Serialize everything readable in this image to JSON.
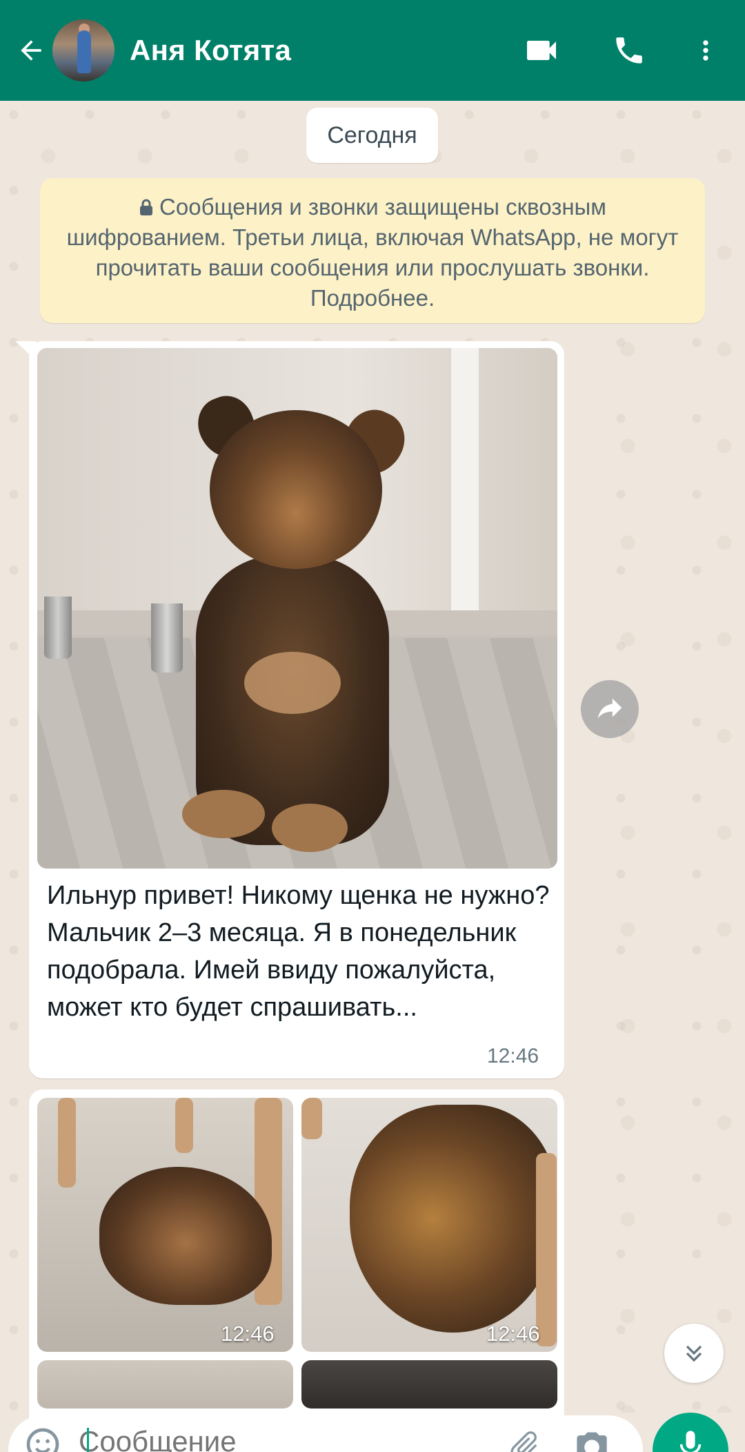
{
  "header": {
    "contact_name": "Аня Котята",
    "icons": {
      "back": "arrow-back-icon",
      "video": "video-call-icon",
      "voice": "phone-icon",
      "menu": "more-vert-icon"
    }
  },
  "date_chip": "Сегодня",
  "encryption_notice": "Сообщения и звонки защищены сквозным шифрованием. Третьи лица, включая WhatsApp, не могут прочитать ваши сообщения или прослушать звонки. Подробнее.",
  "messages": [
    {
      "type": "image-with-caption",
      "image_icon": "puppy-photo",
      "caption": "Ильнур привет! Никому щенка не нужно? Мальчик 2–3 месяца. Я в понедельник подобрала. Имей ввиду пожалуйста, может кто будет спрашивать...",
      "time": "12:46"
    },
    {
      "type": "image-grid",
      "images": [
        {
          "time": "12:46"
        },
        {
          "time": "12:46"
        }
      ]
    }
  ],
  "composer": {
    "placeholder": "Сообщение",
    "icons": {
      "emoji": "emoji-icon",
      "attach": "attach-icon",
      "camera": "camera-icon",
      "mic": "mic-icon"
    }
  },
  "colors": {
    "header": "#008069",
    "accent": "#00a884",
    "notice_bg": "#fdf1c7",
    "chat_bg": "#efe7dd"
  }
}
